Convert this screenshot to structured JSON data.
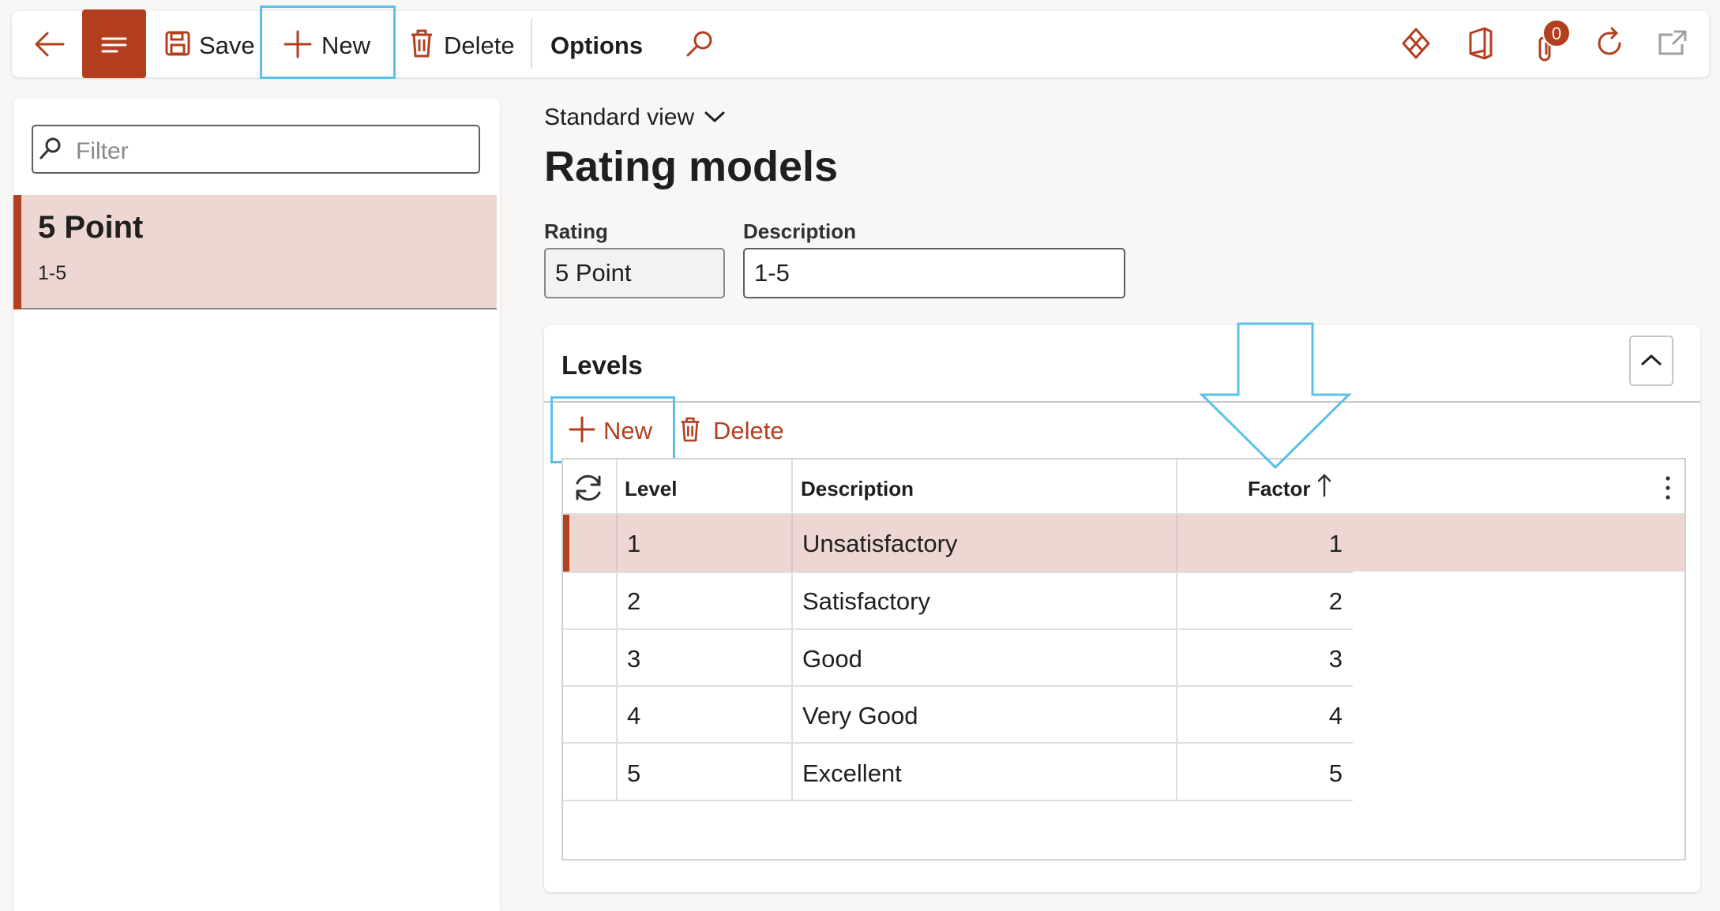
{
  "toolbar": {
    "save_label": "Save",
    "new_label": "New",
    "delete_label": "Delete",
    "options_label": "Options",
    "notification_count": "0"
  },
  "left": {
    "filter_placeholder": "Filter",
    "items": [
      {
        "title": "5 Point",
        "subtitle": "1-5"
      }
    ]
  },
  "main": {
    "view_label": "Standard view",
    "title": "Rating models",
    "fields": {
      "rating_label": "Rating",
      "rating_value": "5 Point",
      "description_label": "Description",
      "description_value": "1-5"
    }
  },
  "levels": {
    "title": "Levels",
    "new_label": "New",
    "delete_label": "Delete",
    "columns": [
      "Level",
      "Description",
      "Factor"
    ],
    "rows": [
      {
        "level": "1",
        "description": "Unsatisfactory",
        "factor": "1"
      },
      {
        "level": "2",
        "description": "Satisfactory",
        "factor": "2"
      },
      {
        "level": "3",
        "description": "Good",
        "factor": "3"
      },
      {
        "level": "4",
        "description": "Very Good",
        "factor": "4"
      },
      {
        "level": "5",
        "description": "Excellent",
        "factor": "5"
      }
    ]
  },
  "colors": {
    "accent": "#b33f1f",
    "selected_row": "#ecd7d3",
    "callout": "#5bc0e8"
  },
  "icons": {
    "back": "arrow-left-icon",
    "menu": "hamburger-icon",
    "save": "floppy-disk-icon",
    "new": "plus-icon",
    "delete": "trash-icon",
    "search": "search-icon",
    "power_platform": "diamond-icon",
    "office": "office-icon",
    "attachments": "paperclip-icon",
    "refresh": "refresh-icon",
    "open_new": "open-in-new-window-icon",
    "collapse": "chevron-up-icon",
    "view_dropdown": "chevron-down-icon",
    "grid_refresh": "sync-icon",
    "sort": "sort-ascending-icon",
    "more": "more-vertical-icon"
  }
}
